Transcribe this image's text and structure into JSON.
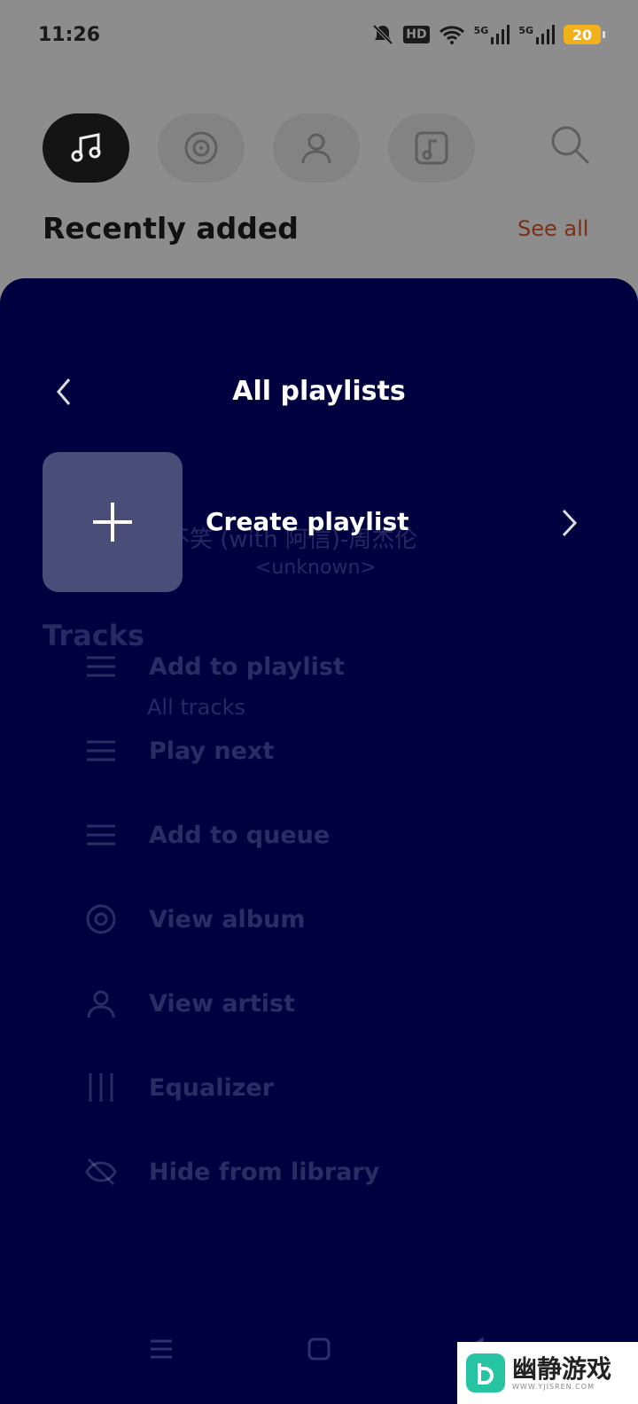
{
  "status_bar": {
    "time": "11:26",
    "icons": [
      "bell-muted-icon",
      "hd-icon",
      "wifi-icon",
      "5g-signal-icon",
      "5g-signal-icon"
    ],
    "hd_label": "HD",
    "network_1": "5G",
    "network_2": "5G",
    "battery": "20"
  },
  "background": {
    "nav_tabs": [
      "music-note-icon",
      "album-disc-icon",
      "artist-icon",
      "playlist-icon"
    ],
    "search_icon": "search-icon",
    "section_title": "Recently added",
    "see_all": "See all",
    "faded_rows": [
      "说好不笑 (with 阿信)-周杰伦",
      "<unknown>",
      "Tracks",
      "All tracks"
    ],
    "menu_items": [
      "Add to playlist",
      "Play next",
      "Add to queue",
      "View album",
      "View artist",
      "Equalizer",
      "Hide from library"
    ]
  },
  "sheet": {
    "title": "All playlists",
    "back_icon": "chevron-left-icon",
    "create_label": "Create playlist",
    "create_icon": "plus-icon",
    "forward_icon": "chevron-right-icon"
  },
  "system_nav": [
    "menu-icon",
    "home-square-icon",
    "back-triangle-icon"
  ],
  "watermark": {
    "text": "幽静游戏",
    "sub": "WWW.YJISREN.COM"
  },
  "colors": {
    "sheet_bg": "#000040",
    "tile_bg": "#4a4d78",
    "see_all": "#7a3018",
    "battery": "#f2b01a"
  }
}
